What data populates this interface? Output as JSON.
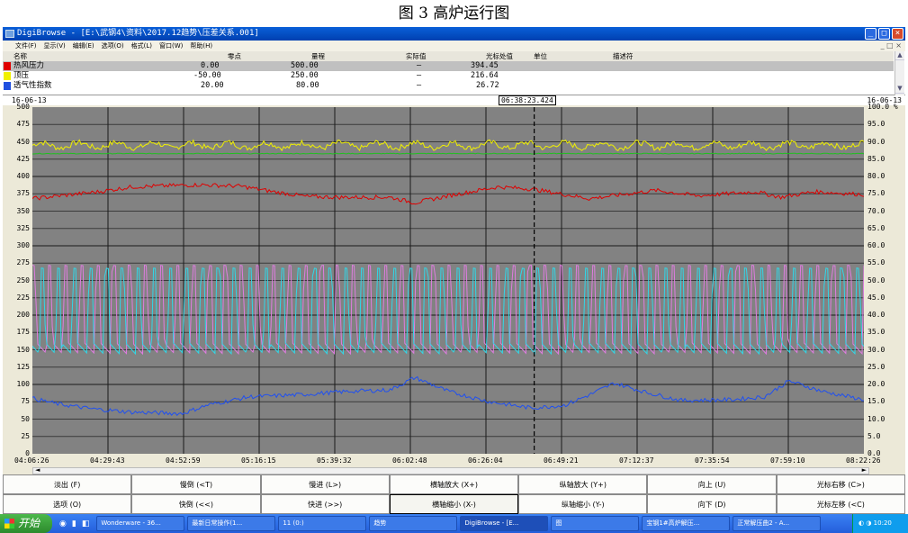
{
  "caption": "图 3  高炉运行图",
  "window": {
    "title": "DigiBrowse - [E:\\武钢4\\资料\\2017.12趋势\\压差关系.001]",
    "buttons": [
      "_",
      "□",
      "×"
    ]
  },
  "menu": [
    "文件(F)",
    "显示(V)",
    "编辑(E)",
    "选项(O)",
    "格式(L)",
    "窗口(W)",
    "帮助(H)"
  ],
  "mdi_controls": "_ □ ×",
  "legend": {
    "headers": {
      "name": "名称",
      "zero": "零点",
      "span": "量程",
      "actual": "实际值",
      "cursor": "光标处值",
      "unit": "单位",
      "desc": "描述符"
    },
    "rows": [
      {
        "color": "#e00000",
        "name": "热风压力",
        "zero": "0.00",
        "span": "500.00",
        "actual": "—",
        "cursor": "394.45",
        "unit": ""
      },
      {
        "color": "#f0f000",
        "name": "顶压",
        "zero": "-50.00",
        "span": "250.00",
        "actual": "—",
        "cursor": "216.64",
        "unit": ""
      },
      {
        "color": "#2050e0",
        "name": "透气性指数",
        "zero": "20.00",
        "span": "80.00",
        "actual": "—",
        "cursor": "26.72",
        "unit": ""
      }
    ]
  },
  "date_left": "16-06-13",
  "date_right": "16-06-13",
  "cursor_time": "06:38:23.424",
  "y_left_labels": [
    "500",
    "475",
    "450",
    "425",
    "400",
    "375",
    "350",
    "325",
    "300",
    "275",
    "250",
    "225",
    "200",
    "175",
    "150",
    "125",
    "100",
    "75",
    "50",
    "25",
    "0"
  ],
  "y_right_labels": [
    "100.0 %",
    "95.0",
    "90.0",
    "85.0",
    "80.0",
    "75.0",
    "70.0",
    "65.0",
    "60.0",
    "55.0",
    "50.0",
    "45.0",
    "40.0",
    "35.0",
    "30.0",
    "25.0",
    "20.0",
    "15.0",
    "10.0",
    "5.0",
    "0.0"
  ],
  "x_labels": [
    "04:06:26",
    "04:29:43",
    "04:52:59",
    "05:16:15",
    "05:39:32",
    "06:02:48",
    "06:26:04",
    "06:49:21",
    "07:12:37",
    "07:35:54",
    "07:59:10",
    "08:22:26"
  ],
  "buttons": [
    "淡出 (F)",
    "慢倒 (<T)",
    "慢进 (L>)",
    "横轴放大 (X+)",
    "纵轴放大 (Y+)",
    "向上 (U)",
    "光标右移 (C>)",
    "选项 (O)",
    "快倒 (<<)",
    "快进 (>>)",
    "横轴缩小 (X-)",
    "纵轴缩小 (Y-)",
    "向下 (D)",
    "光标左移 (<C)"
  ],
  "pressed_button": "横轴缩小 (X-)",
  "taskbar": {
    "start": "开始",
    "tasks": [
      "Wonderware - 36...",
      "最新日常操作(1...",
      "11 (0:)",
      "趋势",
      "DigiBrowse - [E...",
      "图",
      "宝钢1#高炉解压...",
      "正常解压曲2 - A..."
    ],
    "active": "DigiBrowse - [E...",
    "clock": "10:20"
  },
  "chart_data": {
    "type": "line",
    "ylim": [
      0,
      500
    ],
    "y2lim": [
      0,
      100
    ],
    "grid": true,
    "cursor_at": "06:38:23",
    "series": [
      {
        "name": "热风压力",
        "color": "#f0f000",
        "shape": "noisy",
        "level": 445,
        "amp": 4,
        "noise": 4
      },
      {
        "name": "",
        "color": "#20c020",
        "shape": "flat",
        "level": 433,
        "amp": 1
      },
      {
        "name": "顶压",
        "color": "#e00000",
        "shape": "smooth",
        "profile": [
          [
            0,
            368
          ],
          [
            0.08,
            378
          ],
          [
            0.12,
            385
          ],
          [
            0.2,
            388
          ],
          [
            0.25,
            386
          ],
          [
            0.29,
            378
          ],
          [
            0.33,
            371
          ],
          [
            0.37,
            370
          ],
          [
            0.43,
            370
          ],
          [
            0.46,
            362
          ],
          [
            0.5,
            372
          ],
          [
            0.56,
            385
          ],
          [
            0.6,
            382
          ],
          [
            0.67,
            368
          ],
          [
            0.75,
            380
          ],
          [
            0.8,
            372
          ],
          [
            0.87,
            378
          ],
          [
            0.9,
            370
          ],
          [
            0.94,
            378
          ],
          [
            1,
            374
          ]
        ]
      },
      {
        "name": "透气性指数",
        "color": "#2050f0",
        "shape": "smooth",
        "profile": [
          [
            0,
            80
          ],
          [
            0.03,
            72
          ],
          [
            0.07,
            65
          ],
          [
            0.12,
            60
          ],
          [
            0.18,
            58
          ],
          [
            0.21,
            70
          ],
          [
            0.26,
            82
          ],
          [
            0.32,
            85
          ],
          [
            0.38,
            90
          ],
          [
            0.43,
            92
          ],
          [
            0.46,
            110
          ],
          [
            0.5,
            90
          ],
          [
            0.55,
            75
          ],
          [
            0.6,
            66
          ],
          [
            0.64,
            70
          ],
          [
            0.67,
            85
          ],
          [
            0.7,
            102
          ],
          [
            0.74,
            88
          ],
          [
            0.78,
            77
          ],
          [
            0.84,
            78
          ],
          [
            0.88,
            82
          ],
          [
            0.91,
            105
          ],
          [
            0.95,
            90
          ],
          [
            1,
            78
          ]
        ]
      },
      {
        "name": "",
        "color": "#e07ce0",
        "shape": "saw",
        "low": 150,
        "high": 272,
        "cycles": 52,
        "phase": 0.1
      },
      {
        "name": "",
        "color": "#30d8e8",
        "shape": "saw",
        "low": 150,
        "high": 268,
        "cycles": 52,
        "phase": 0.55
      }
    ]
  }
}
